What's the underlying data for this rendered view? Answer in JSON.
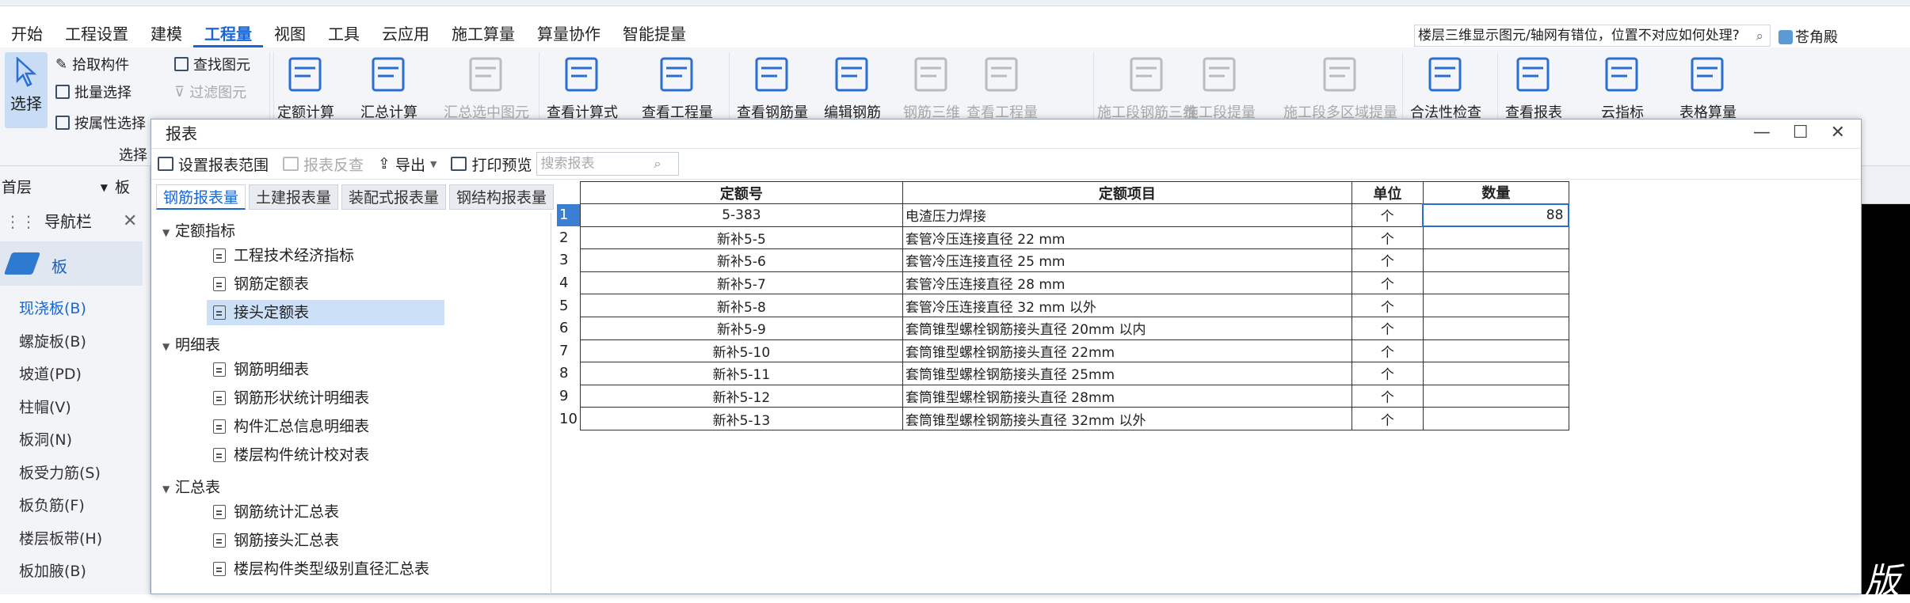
{
  "menu": {
    "items": [
      "开始",
      "工程设置",
      "建模",
      "工程量",
      "视图",
      "工具",
      "云应用",
      "施工算量",
      "算量协作",
      "智能提量"
    ],
    "active_index": 3
  },
  "help_search": {
    "text": "楼层三维显示图元/轴网有错位，位置不对应如何处理?"
  },
  "user": {
    "name": "苍角殿"
  },
  "ribbon": {
    "select_label": "选择",
    "pick_component": "拾取构件",
    "batch_select": "批量选择",
    "attr_select": "按属性选择",
    "find_element": "查找图元",
    "filter_element": "过滤图元",
    "group_label": "选择",
    "big": [
      {
        "label": "定额计算",
        "disabled": false
      },
      {
        "label": "汇总计算",
        "disabled": false
      },
      {
        "label": "汇总选中图元",
        "disabled": true
      },
      {
        "label": "查看计算式",
        "disabled": false
      },
      {
        "label": "查看工程量",
        "disabled": false
      },
      {
        "label": "查看钢筋量",
        "disabled": false
      },
      {
        "label": "编辑钢筋",
        "disabled": false
      },
      {
        "label": "钢筋三维",
        "disabled": true
      },
      {
        "label": "查看工程量",
        "disabled": true
      },
      {
        "label": "施工段钢筋三维",
        "disabled": true
      },
      {
        "label": "施工段提量",
        "disabled": true
      },
      {
        "label": "施工段多区域提量",
        "disabled": true
      },
      {
        "label": "合法性检查",
        "disabled": false
      },
      {
        "label": "查看报表",
        "disabled": false
      },
      {
        "label": "云指标",
        "disabled": false
      },
      {
        "label": "表格算量",
        "disabled": false
      }
    ]
  },
  "left": {
    "floor": "首层",
    "floor_suffix": "板",
    "nav_title": "导航栏",
    "nav_current": "板",
    "items": [
      "现浇板(B)",
      "螺旋板(B)",
      "坡道(PD)",
      "柱帽(V)",
      "板洞(N)",
      "板受力筋(S)",
      "板负筋(F)",
      "楼层板带(H)",
      "板加腋(B)"
    ]
  },
  "dialog": {
    "title": "报表",
    "toolbar": {
      "set_range": "设置报表范围",
      "check_report": "报表反查",
      "export": "导出",
      "print_preview": "打印预览",
      "search_placeholder": "搜索报表"
    },
    "tabs": [
      "钢筋报表量",
      "土建报表量",
      "装配式报表量",
      "钢结构报表量"
    ],
    "tree": {
      "groups": [
        {
          "name": "定额指标",
          "items": [
            "工程技术经济指标",
            "钢筋定额表",
            "接头定额表"
          ]
        },
        {
          "name": "明细表",
          "items": [
            "钢筋明细表",
            "钢筋形状统计明细表",
            "构件汇总信息明细表",
            "楼层构件统计校对表"
          ]
        },
        {
          "name": "汇总表",
          "items": [
            "钢筋统计汇总表",
            "钢筋接头汇总表",
            "楼层构件类型级别直径汇总表"
          ]
        }
      ],
      "selected": "接头定额表"
    },
    "table": {
      "headers": [
        "定额号",
        "定额项目",
        "单位",
        "数量"
      ],
      "rows": [
        {
          "no": "1",
          "code": "5-383",
          "item": "电渣压力焊接",
          "unit": "个",
          "qty": "88"
        },
        {
          "no": "2",
          "code": "新补5-5",
          "item": "套管冷压连接直径 22 mm",
          "unit": "个",
          "qty": ""
        },
        {
          "no": "3",
          "code": "新补5-6",
          "item": "套管冷压连接直径 25 mm",
          "unit": "个",
          "qty": ""
        },
        {
          "no": "4",
          "code": "新补5-7",
          "item": "套管冷压连接直径 28 mm",
          "unit": "个",
          "qty": ""
        },
        {
          "no": "5",
          "code": "新补5-8",
          "item": "套管冷压连接直径 32 mm 以外",
          "unit": "个",
          "qty": ""
        },
        {
          "no": "6",
          "code": "新补5-9",
          "item": "套筒锥型螺栓钢筋接头直径 20mm 以内",
          "unit": "个",
          "qty": ""
        },
        {
          "no": "7",
          "code": "新补5-10",
          "item": "套筒锥型螺栓钢筋接头直径 22mm",
          "unit": "个",
          "qty": ""
        },
        {
          "no": "8",
          "code": "新补5-11",
          "item": "套筒锥型螺栓钢筋接头直径 25mm",
          "unit": "个",
          "qty": ""
        },
        {
          "no": "9",
          "code": "新补5-12",
          "item": "套筒锥型螺栓钢筋接头直径 28mm",
          "unit": "个",
          "qty": ""
        },
        {
          "no": "10",
          "code": "新补5-13",
          "item": "套筒锥型螺栓钢筋接头直径 32mm 以外",
          "unit": "个",
          "qty": ""
        }
      ]
    }
  },
  "canvas_text": "版"
}
